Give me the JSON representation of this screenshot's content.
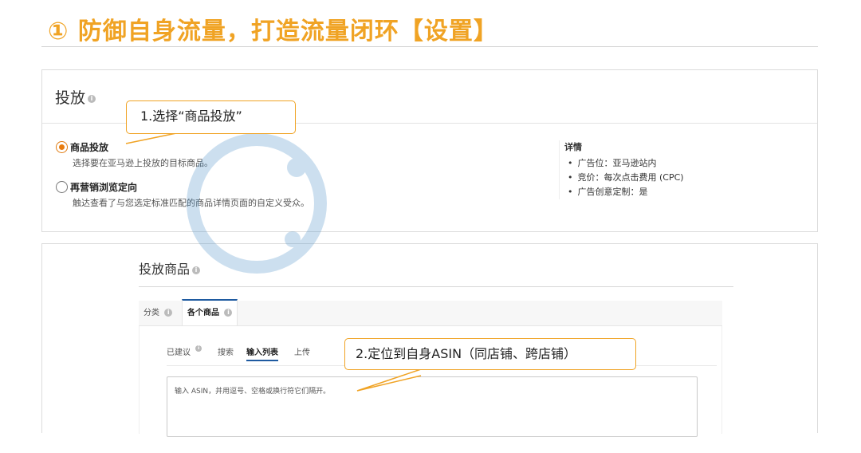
{
  "slide": {
    "title": "① 防御自身流量，打造流量闭环【设置】"
  },
  "targeting": {
    "title": "投放",
    "options": [
      {
        "label": "商品投放",
        "description": "选择要在亚马逊上投放的目标商品。",
        "selected": true
      },
      {
        "label": "再营销浏览定向",
        "description": "触达查看了与您选定标准匹配的商品详情页面的自定义受众。",
        "selected": false
      }
    ],
    "details": {
      "title": "详情",
      "items": [
        "广告位：亚马逊站内",
        "竞价：每次点击费用 (CPC)",
        "广告创意定制：是"
      ]
    }
  },
  "products": {
    "title": "投放商品",
    "tabs": [
      "分类",
      "各个商品"
    ],
    "active_tab": "各个商品",
    "subtabs": [
      "已建议",
      "搜索",
      "输入列表",
      "上传"
    ],
    "active_subtab": "输入列表",
    "asin_placeholder": "输入 ASIN，并用逗号、空格或换行符它们隔开。"
  },
  "callouts": {
    "step1": "1.选择“商品投放”",
    "step2": "2.定位到自身ASIN（同店铺、跨店铺）"
  },
  "colors": {
    "accent": "#f0a324",
    "radio_selected": "#e87c0f",
    "tab_active": "#1e5aa0",
    "watermark": "#4a90c8"
  }
}
